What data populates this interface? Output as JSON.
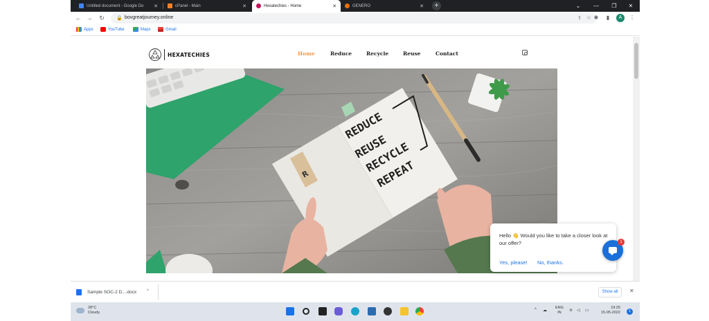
{
  "browser": {
    "tabs": [
      {
        "title": "Untitled document - Google Do",
        "favicon_color": "#4285f4",
        "active": false
      },
      {
        "title": "cPanel - Main",
        "favicon_color": "#f4812a",
        "active": false
      },
      {
        "title": "Hexatechies - Home",
        "favicon_color": "#c2185b",
        "active": true
      },
      {
        "title": "GENERO",
        "favicon_color": "#e8710a",
        "active": false
      }
    ],
    "new_tab_glyph": "+",
    "url": "bovgreatjourney.online",
    "profile_initial": "A",
    "bookmarks": [
      {
        "label": "Apps",
        "icon": "apps-grid-icon"
      },
      {
        "label": "YouTube",
        "icon": "youtube-icon"
      },
      {
        "label": "Maps",
        "icon": "maps-icon"
      },
      {
        "label": "Gmail",
        "icon": "gmail-icon"
      }
    ]
  },
  "site": {
    "brand": "HEXATECHIES",
    "nav": [
      {
        "label": "Home",
        "active": true
      },
      {
        "label": "Reduce",
        "active": false
      },
      {
        "label": "Recycle",
        "active": false
      },
      {
        "label": "Reuse",
        "active": false
      },
      {
        "label": "Contact",
        "active": false
      }
    ],
    "accent": "#f2994a",
    "hero_words": [
      "REDUCE",
      "REUSE",
      "RECYCLE",
      "REPEAT"
    ],
    "hero_tag_letter": "R"
  },
  "chat": {
    "message": "Hello 👋 Would you like to take a closer look at our offer?",
    "options": [
      "Yes, please!",
      "No, thanks."
    ],
    "badge_count": "1"
  },
  "downloads": {
    "file": "Sample SOC-2 D....docx",
    "show_all": "Show all"
  },
  "taskbar": {
    "temperature": "28°C",
    "condition": "Cloudy",
    "lang": "ENG",
    "region": "IN",
    "time": "19:25",
    "date": "15-05-2022",
    "notification_count": "1"
  }
}
